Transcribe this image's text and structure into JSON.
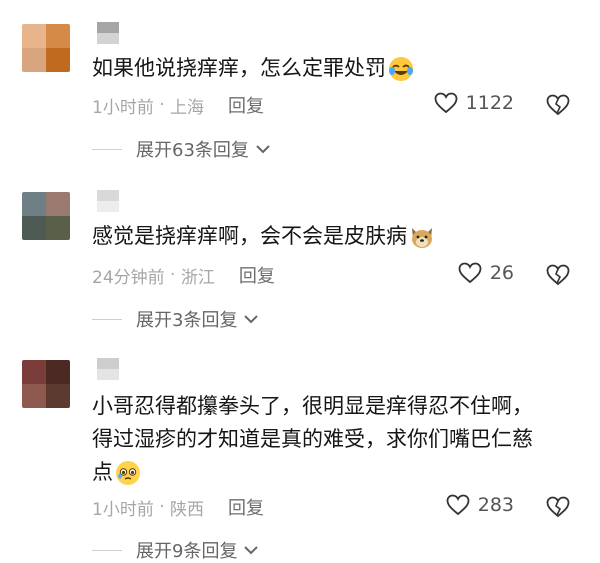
{
  "comments": [
    {
      "text": "如果他说挠痒痒，怎么定罪处罚",
      "emoji": "laughing-crying-emoji",
      "time": "1小时前",
      "location": "上海",
      "reply_label": "回复",
      "likes": "1122",
      "expand_label": "展开63条回复",
      "avatar_colors": [
        "#e8b48c",
        "#d68a47",
        "#d9a57e",
        "#c06a1f"
      ],
      "name_colors": [
        "#9c9c9c",
        "#cfcfcf"
      ]
    },
    {
      "text": "感觉是挠痒痒啊，会不会是皮肤病",
      "emoji": "dog-face-emoji",
      "time": "24分钟前",
      "location": "浙江",
      "reply_label": "回复",
      "likes": "26",
      "expand_label": "展开3条回复",
      "avatar_colors": [
        "#6e7f86",
        "#9a7a6e",
        "#4d5b54",
        "#5a5f4a"
      ],
      "name_colors": [
        "#d5d5d5",
        "#ececec"
      ]
    },
    {
      "text": "小哥忍得都攥拳头了，很明显是痒得忍不住啊，\n得过湿疹的才知道是真的难受，求你们嘴巴仁慈\n点",
      "emoji": "pleading-face-emoji",
      "time": "1小时前",
      "location": "陕西",
      "reply_label": "回复",
      "likes": "283",
      "expand_label": "展开9条回复",
      "avatar_colors": [
        "#7a3d3a",
        "#4a2a22",
        "#8e5a50",
        "#5c3a30"
      ],
      "name_colors": [
        "#c9c9c9",
        "#e2e2e2"
      ]
    }
  ],
  "icons": {
    "like": "heart-outline-icon",
    "dislike": "broken-heart-outline-icon",
    "expand": "chevron-down-icon"
  }
}
